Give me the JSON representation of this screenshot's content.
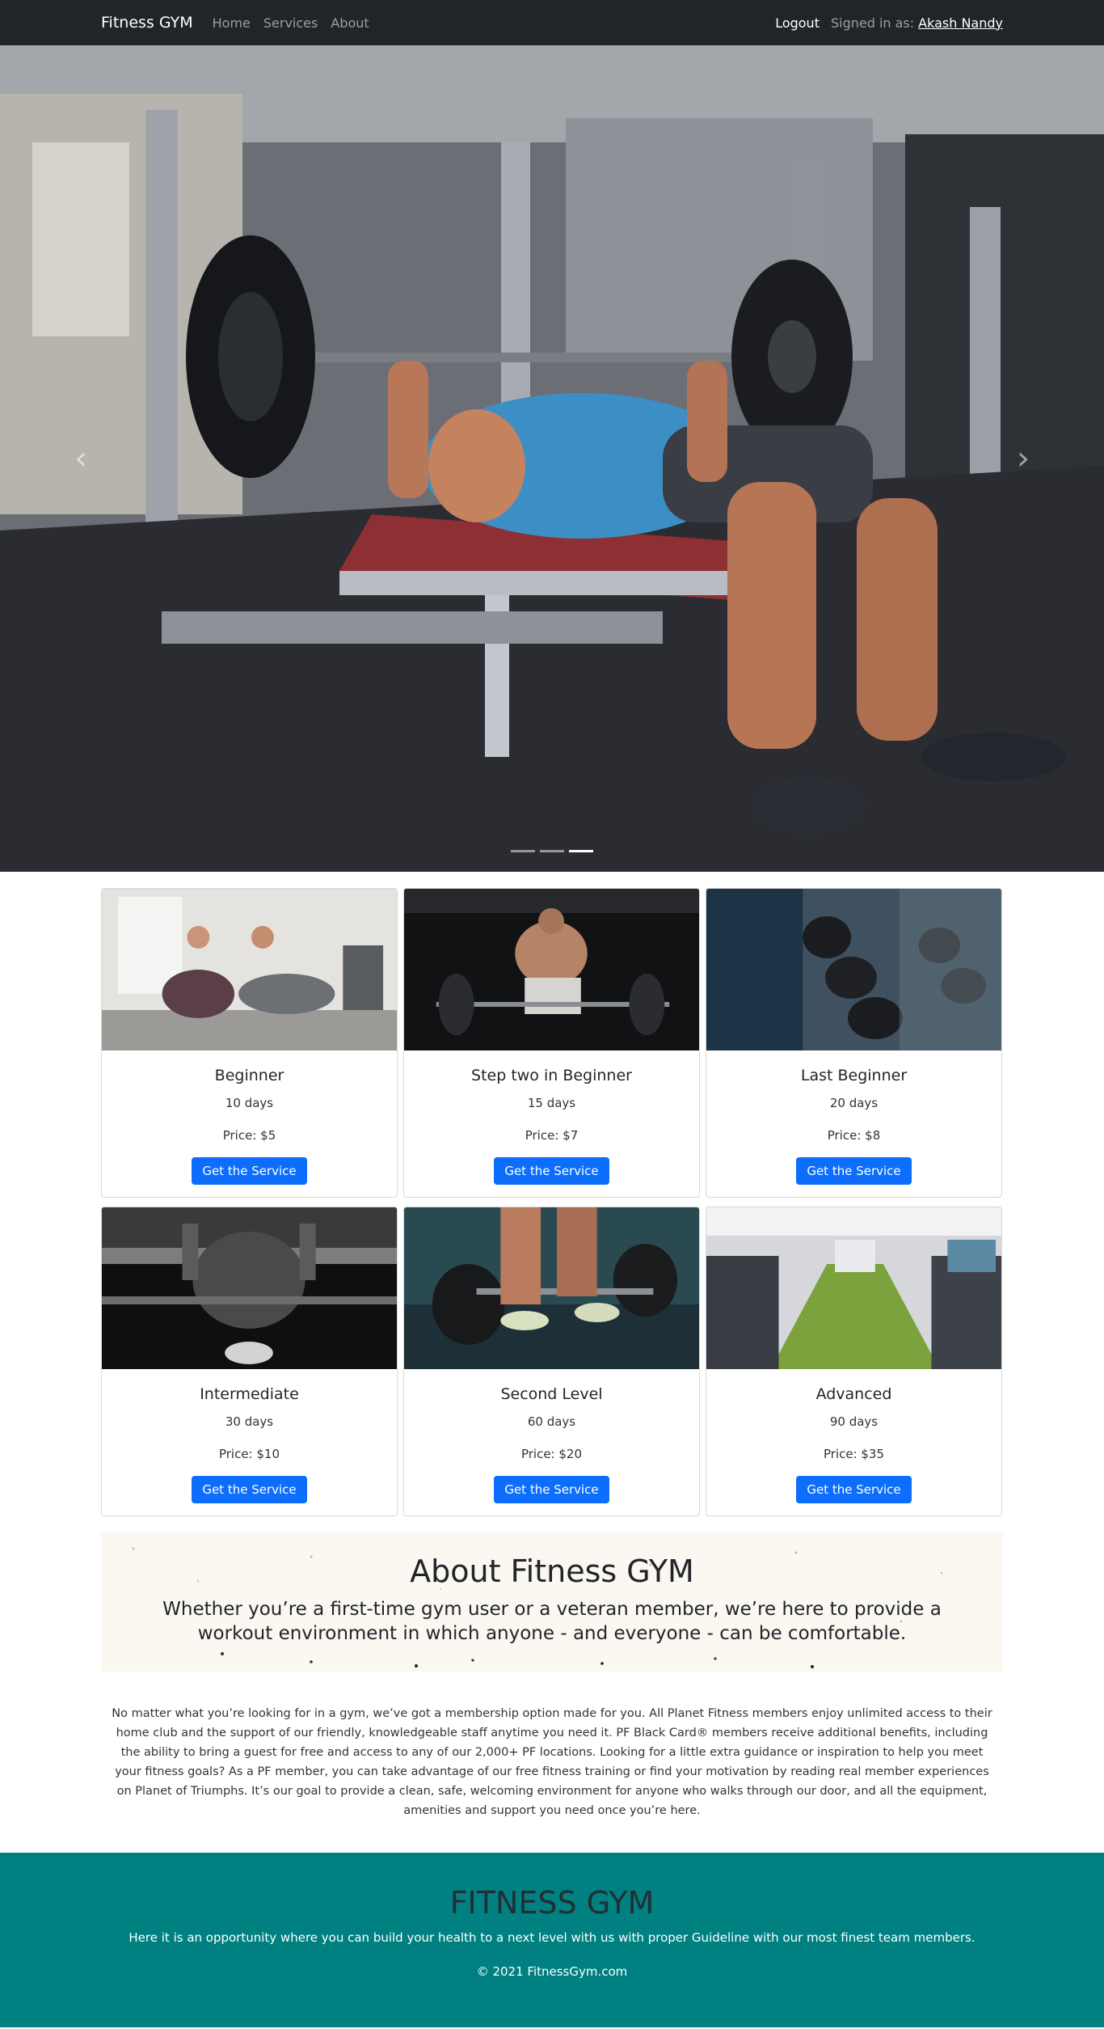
{
  "navbar": {
    "brand": "Fitness GYM",
    "links": [
      "Home",
      "Services",
      "About"
    ],
    "logout": "Logout",
    "signed_in_label": "Signed in as:",
    "user_name": "Akash Nandy"
  },
  "carousel": {
    "prev_icon": "chevron-left-icon",
    "next_icon": "chevron-right-icon",
    "indicator_count": 3,
    "active_index": 2
  },
  "services": [
    {
      "title": "Beginner",
      "days": "10 days",
      "price": "Price: $5",
      "button": "Get the Service"
    },
    {
      "title": "Step two in Beginner",
      "days": "15 days",
      "price": "Price: $7",
      "button": "Get the Service"
    },
    {
      "title": "Last Beginner",
      "days": "20 days",
      "price": "Price: $8",
      "button": "Get the Service"
    },
    {
      "title": "Intermediate",
      "days": "30 days",
      "price": "Price: $10",
      "button": "Get the Service"
    },
    {
      "title": "Second Level",
      "days": "60 days",
      "price": "Price: $20",
      "button": "Get the Service"
    },
    {
      "title": "Advanced",
      "days": "90 days",
      "price": "Price: $35",
      "button": "Get the Service"
    }
  ],
  "about": {
    "title": "About Fitness GYM",
    "subtitle": "Whether you’re a first-time gym user or a veteran member, we’re here to provide a workout environment in which anyone - and everyone - can be comfortable.",
    "body": "No matter what you’re looking for in a gym, we’ve got a membership option made for you. All Planet Fitness members enjoy unlimited access to their home club and the support of our friendly, knowledgeable staff anytime you need it. PF Black Card® members receive additional benefits, including the ability to bring a guest for free and access to any of our 2,000+ PF locations. Looking for a little extra guidance or inspiration to help you meet your fitness goals? As a PF member, you can take advantage of our free fitness training or find your motivation by reading real member experiences on Planet of Triumphs. It’s our goal to provide a clean, safe, welcoming environment for anyone who walks through our door, and all the equipment, amenities and support you need once you’re here."
  },
  "footer": {
    "title": "FITNESS GYM",
    "tagline": "Here it is an opportunity where you can build your health to a next level with us with proper Guideline with our most finest team members.",
    "copyright": "© 2021 FitnessGym.com"
  },
  "colors": {
    "navbar_bg": "#212529",
    "primary_button": "#0d6efd",
    "footer_bg": "#008080",
    "about_bg": "#fbf7f1"
  }
}
